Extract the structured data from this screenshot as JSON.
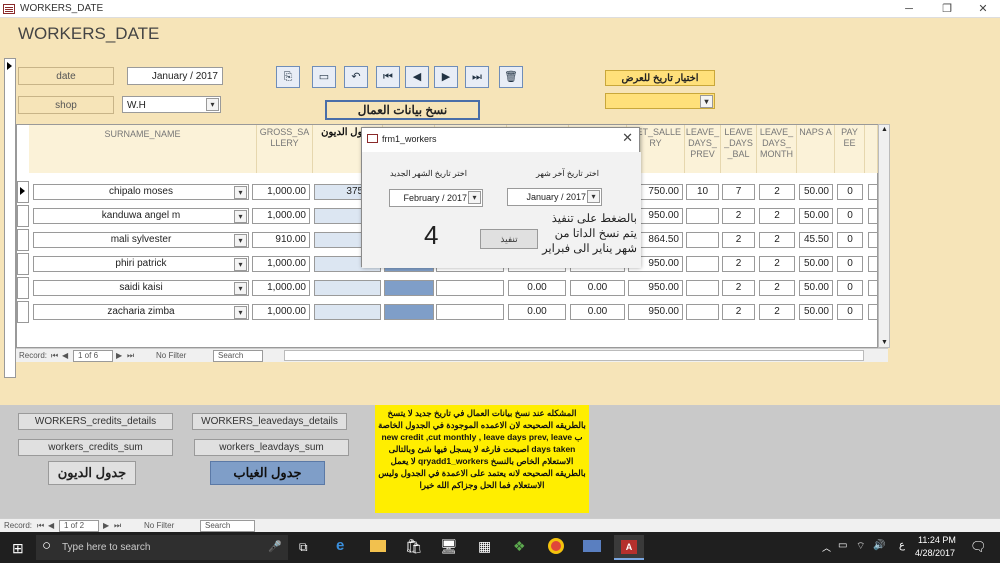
{
  "window": {
    "title": "WORKERS_DATE",
    "min": "─",
    "restore": "❐",
    "close": "✕"
  },
  "form": {
    "header": "WORKERS_DATE"
  },
  "top": {
    "date_label": "date",
    "date_value": "January / 2017",
    "shop_label": "shop",
    "shop_value": "W.H",
    "nav": [
      "⎘",
      "▭",
      "↶",
      "⏮",
      "◀",
      "▶",
      "⏭",
      "🗑"
    ],
    "display_date_label": "اختيار تاريخ للعرض",
    "display_date_value": "",
    "copy_button": "نسخ بيانات العمال"
  },
  "grid": {
    "headers": [
      {
        "key": "surname",
        "label": "SURNAME_NAME"
      },
      {
        "key": "gross",
        "label": "GROSS_SA LLERY"
      },
      {
        "key": "debt",
        "label": "جدول الديون"
      },
      {
        "key": "c4",
        "label": ""
      },
      {
        "key": "c5",
        "label": ""
      },
      {
        "key": "c6",
        "label": ""
      },
      {
        "key": "c7",
        "label": ""
      },
      {
        "key": "net",
        "label": "NET_SALLE RY"
      },
      {
        "key": "prev",
        "label": "LEAVE_ DAYS_ PREV"
      },
      {
        "key": "bal",
        "label": "LEAVE _DAYS _BAL"
      },
      {
        "key": "month",
        "label": "LEAVE_ DAYS_ MONTH"
      },
      {
        "key": "napsa",
        "label": "NAPS A"
      },
      {
        "key": "paye",
        "label": "PAY EE"
      }
    ],
    "rows": [
      {
        "name": "chipalo moses",
        "gross": "1,000.00",
        "debt": "375.00",
        "c5": "",
        "c6": "",
        "c7": "",
        "net": "750.00",
        "prev": "10",
        "bal": "7",
        "month": "2",
        "napsa": "50.00",
        "paye": "0"
      },
      {
        "name": "kanduwa angel m",
        "gross": "1,000.00",
        "debt": "",
        "c5": "",
        "c6": "",
        "c7": "",
        "net": "950.00",
        "prev": "",
        "bal": "2",
        "month": "2",
        "napsa": "50.00",
        "paye": "0"
      },
      {
        "name": "mali sylvester",
        "gross": "910.00",
        "debt": "",
        "c5": "",
        "c6": "",
        "c7": "",
        "net": "864.50",
        "prev": "",
        "bal": "2",
        "month": "2",
        "napsa": "45.50",
        "paye": "0"
      },
      {
        "name": "phiri patrick",
        "gross": "1,000.00",
        "debt": "",
        "c5": "",
        "c6": "",
        "c7": "",
        "net": "950.00",
        "prev": "",
        "bal": "2",
        "month": "2",
        "napsa": "50.00",
        "paye": "0"
      },
      {
        "name": "saidi kaisi",
        "gross": "1,000.00",
        "debt": "",
        "c5": "",
        "c6": "0.00",
        "c7": "0.00",
        "net": "950.00",
        "prev": "",
        "bal": "2",
        "month": "2",
        "napsa": "50.00",
        "paye": "0"
      },
      {
        "name": "zacharia zimba",
        "gross": "1,000.00",
        "debt": "",
        "c5": "",
        "c6": "0.00",
        "c7": "0.00",
        "net": "950.00",
        "prev": "",
        "bal": "2",
        "month": "2",
        "napsa": "50.00",
        "paye": "0"
      }
    ],
    "record_bar": {
      "label": "Record:",
      "position": "1 of 6",
      "filter": "No Filter",
      "search": "Search"
    }
  },
  "dialog": {
    "title": "frm1_workers",
    "close": "✕",
    "new_month_label": "اختر تاريخ الشهر الجديد",
    "new_month_value": "February / 2017",
    "last_month_label": "اختر تاريخ آخر شهر",
    "last_month_value": "January / 2017",
    "big_number": "4",
    "execute_button": "تنفيذ",
    "explain": "بالضغط على تنفيذ يتم نسخ الداتا من شهر يناير الى فبراير"
  },
  "bottom": {
    "credits_details": "WORKERS_credits_details",
    "leavedays_details": "WORKERS_leavedays_details",
    "credits_sum": "workers_credits_sum",
    "leavdays_sum": "workers_leavdays_sum",
    "debts_table": "جدول الديون",
    "absence_table": "جدول الغياب",
    "note": "المشكله عند نسخ بيانات العمال في تاريخ جديد لا يتسخ بالطريقه الصحيحه لان الاعمده الموجودة في الجدول الخاصة ب new credit ,cut monthly , leave days prev, leave days taken اصبحت فارغه لا يسجل فيها شئ وبالتالى الاستعلام الخاص بالنسخ qryadd1_workers لا يعمل بالطريقه الصحيحه لانه يعتمد على الاعمدة في الجدول وليس الاستعلام فما الحل وجزاكم الله خيرا"
  },
  "record_bar2": {
    "label": "Record:",
    "position": "1 of 2",
    "filter": "No Filter",
    "search": "Search"
  },
  "taskbar": {
    "search_placeholder": "Type here to search",
    "time": "11:24 PM",
    "date": "4/28/2017",
    "lang": "ع"
  }
}
